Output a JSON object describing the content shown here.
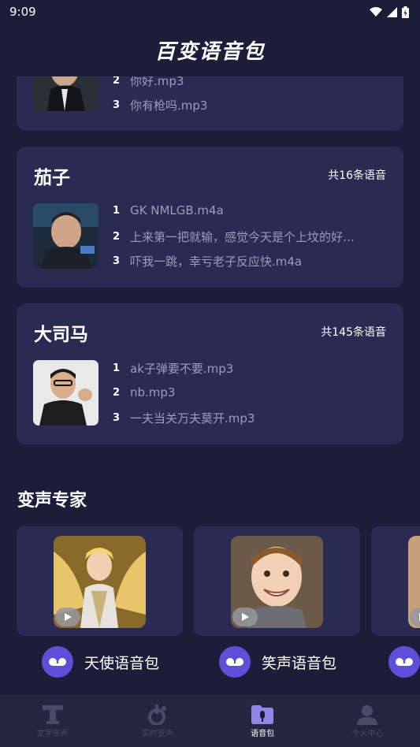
{
  "status_bar": {
    "time": "9:09"
  },
  "header": {
    "title": "百变语音包"
  },
  "cards": [
    {
      "name": "",
      "count": "",
      "tracks": [
        {
          "num": "2",
          "title": "你好.mp3"
        },
        {
          "num": "3",
          "title": "你有枪吗.mp3"
        }
      ]
    },
    {
      "name": "茄子",
      "count": "共16条语音",
      "tracks": [
        {
          "num": "1",
          "title": "GK  NMLGB.m4a"
        },
        {
          "num": "2",
          "title": "上来第一把就输，感觉今天是个上坟的好…"
        },
        {
          "num": "3",
          "title": "吓我一跳，幸亏老子反应快.m4a"
        }
      ]
    },
    {
      "name": "大司马",
      "count": "共145条语音",
      "tracks": [
        {
          "num": "1",
          "title": "ak子弹要不要.mp3"
        },
        {
          "num": "2",
          "title": "nb.mp3"
        },
        {
          "num": "3",
          "title": "一夫当关万夫莫开.mp3"
        }
      ]
    }
  ],
  "experts": {
    "title": "变声专家",
    "items": [
      {
        "label": "天使语音包"
      },
      {
        "label": "笑声语音包"
      },
      {
        "label": ""
      }
    ]
  },
  "nav": [
    {
      "label": "文字变声",
      "icon": "text-t-icon"
    },
    {
      "label": "实时变声",
      "icon": "realtime-voice-icon"
    },
    {
      "label": "语音包",
      "icon": "voice-pack-icon"
    },
    {
      "label": "个人中心",
      "icon": "person-icon"
    }
  ],
  "colors": {
    "background": "#1c1d39",
    "card": "#2a2b52",
    "accent": "#5c4fd8",
    "muted_text": "#9b9cb8",
    "nav_bg": "#25263f"
  }
}
